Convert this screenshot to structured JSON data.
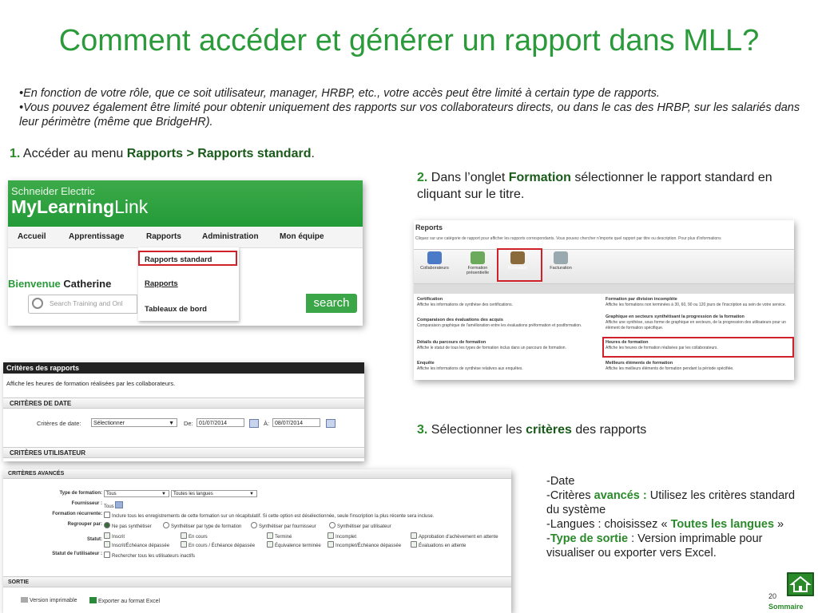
{
  "title": "Comment accéder et générer un rapport dans MLL?",
  "intro": [
    "•En fonction de votre rôle, que ce soit utilisateur, manager, HRBP, etc., votre accès peut être limité à certain type de rapports.",
    "•Vous pouvez également être limité pour obtenir uniquement des rapports sur vos collaborateurs directs, ou dans le cas des HRBP, sur les salariés dans leur périmètre (même que BridgeHR)."
  ],
  "step1": {
    "num": "1.",
    "pre": " Accéder au menu ",
    "bold": "Rapports > Rapports standard",
    "post": "."
  },
  "step2": {
    "num": "2.",
    "pre": " Dans l’onglet ",
    "bold": "Formation",
    "post": " sélectionner le rapport standard en cliquant sur le titre."
  },
  "step3": {
    "num": "3.",
    "pre": " Sélectionner les ",
    "bold": "critères",
    "post": " des rapports"
  },
  "mll": {
    "brand_line1": "Schneider Electric",
    "brand_my": "My",
    "brand_learning": "Learning",
    "brand_link": "Link",
    "nav": [
      "Accueil",
      "Apprentissage",
      "Rapports",
      "Administration",
      "Mon équipe"
    ],
    "menu": [
      "Rapports standard",
      "Rapports",
      "Tableaux de bord"
    ],
    "welcome_green": "Bienvenue",
    "welcome_name": " Catherine",
    "search_placeholder": "Search Training and Onl",
    "search_button": "search"
  },
  "reports": {
    "title": "Reports",
    "desc": "Cliquez sur une catégorie de rapport pour afficher les rapports correspondants. Vous pouvez chercher n'importe quel rapport par titre ou description. Pour plus d'informations",
    "icons": [
      "Collaborateurs",
      "Formation présentielle",
      "Formation",
      "Facturation"
    ],
    "icon_colors": [
      "#4a7ac8",
      "#6aaa5a",
      "#8a6a3a",
      "#9aa8b0"
    ],
    "rows_left": [
      {
        "t": "Certification",
        "d": "Affiche les informations de synthèse des certifications."
      },
      {
        "t": "Comparaison des évaluations des acquis",
        "d": "Comparaison graphique de l'amélioration entre les évaluations préformation et postformation."
      },
      {
        "t": "Détails du parcours de formation",
        "d": "Affiche le statut de tous les types de formation inclus dans un parcours de formation."
      },
      {
        "t": "Enquête",
        "d": "Affiche les informations de synthèse relatives aux enquêtes."
      }
    ],
    "rows_right": [
      {
        "t": "Formation par division incomplète",
        "d": "Affiche les formations non terminées à 30, 60, 90 ou 120 jours de l'inscription au sein de votre service."
      },
      {
        "t": "Graphique en secteurs synthétisant la progression de la formation",
        "d": "Affiche une synthèse, sous forme de graphique en secteurs, de la progression des utilisateurs pour un élément de formation spécifique."
      },
      {
        "t": "Heures de formation",
        "d": "Affiche les heures de formation réalisées par les collaborateurs."
      },
      {
        "t": "Meilleurs éléments de formation",
        "d": "Affiche les meilleurs éléments de formation pendant la période spécifiée."
      }
    ]
  },
  "criteria": {
    "header": "Critères des rapports",
    "desc": "Affiche les heures de formation réalisées par les collaborateurs.",
    "sec_date": "CRITÈRES DE DATE",
    "date_label": "Critères de date:",
    "date_select": "Sélectionner",
    "de_label": "De:",
    "de_value": "01/07/2014",
    "a_label": "À:",
    "a_value": "08/07/2014",
    "sec_user": "CRITÈRES UTILISATEUR"
  },
  "advanced": {
    "header": "CRITÈRES AVANCÉS",
    "type_label": "Type de formation:",
    "type_value": "Tous",
    "lang_value": "Toutes les langues",
    "four_label": "Fournisseur :",
    "four_value": "Tous",
    "rec_label": "Formation récurrente:",
    "rec_value": "Inclure tous les enregistrements de cette formation sur un récapitulatif. Si cette option est désélectionnée, seule l'inscription la plus récente sera incluse.",
    "grp_label": "Regrouper par:",
    "grp_options": [
      "Ne pas synthétiser",
      "Synthétiser par type de formation",
      "Synthétiser par fournisseur",
      "Synthétiser par utilisateur"
    ],
    "statut_label": "Statut:",
    "statut_row1": [
      "Inscrit",
      "En cours",
      "Terminé",
      "Incomplet",
      "Approbation d'achèvement en attente"
    ],
    "statut_row2": [
      "Inscrit/Échéance dépassée",
      "En cours / Échéance dépassée",
      "Équivalence terminée",
      "Incomplet/Échéance dépassée",
      "Évaluations en attente"
    ],
    "user_label": "Statut de l'utilisateur :",
    "user_value": "Rechercher tous les utilisateurs inactifs",
    "sortie": "SORTIE",
    "print": "Version imprimable",
    "excel": "Exporter au format Excel"
  },
  "right": {
    "l1": "-Date",
    "l2a": "-Critères ",
    "l2b": "avancés :",
    "l2c": " Utilisez les critères standard du système",
    "l3a": "-Langues : choisissez « ",
    "l3b": "Toutes les langues",
    "l3c": " »",
    "l4a": "-",
    "l4b": "Type de sortie",
    "l4c": " : Version imprimable pour visualiser ou exporter vers Excel."
  },
  "page_number": "20",
  "sommaire": "Sommaire"
}
